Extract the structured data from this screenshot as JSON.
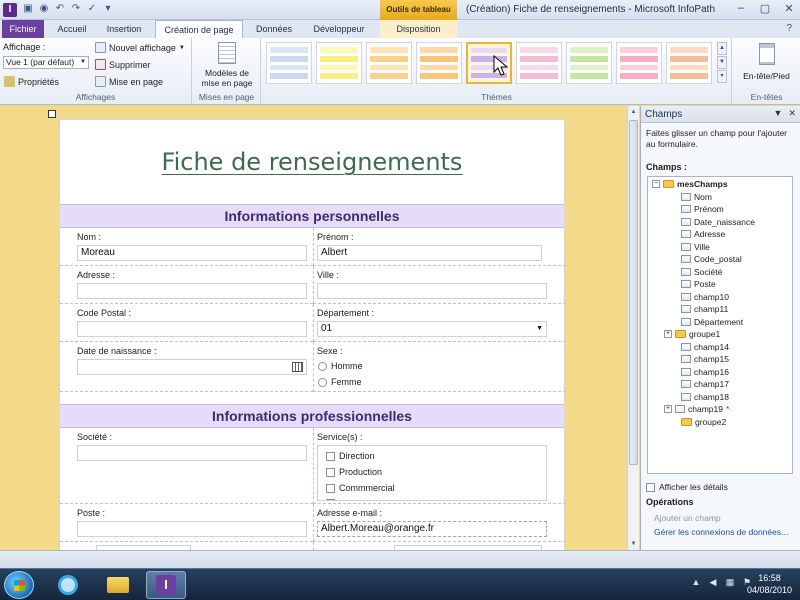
{
  "window": {
    "title": "(Création) Fiche de renseignements - Microsoft InfoPath",
    "app_icon_letter": "I",
    "context_tab_group": "Outils de tableau",
    "controls": [
      "–",
      "▢",
      "✕"
    ]
  },
  "tabs": [
    "Fichier",
    "Accueil",
    "Insertion",
    "Création de page",
    "Données",
    "Développeur",
    "Disposition"
  ],
  "ribbon": {
    "affichages": {
      "view_label": "Affichage :",
      "new_view": "Nouvel affichage",
      "view_value": "Vue 1 (par défaut)",
      "delete": "Supprimer",
      "properties": "Propriétés",
      "layout": "Mise en page",
      "group": "Affichages"
    },
    "mises_en_page": {
      "models_line1": "Modèles de",
      "models_line2": "mise en page",
      "group": "Mises en page"
    },
    "themes": {
      "group": "Thèmes",
      "swatches": [
        [
          "#dbe6f4",
          "#cbd9ec",
          "#dbe6f4",
          "#cbd9ec"
        ],
        [
          "#fbf7b4",
          "#f5ef86",
          "#fbf7b4",
          "#f5ef86"
        ],
        [
          "#fde3b5",
          "#fbd08c",
          "#fde3b5",
          "#fbd08c"
        ],
        [
          "#fdd9a8",
          "#fbc47b",
          "#fdd9a8",
          "#fbc47b"
        ],
        [
          "#e6dbf8",
          "#c7b4ef",
          "#e6dbf8",
          "#c7b4ef"
        ],
        [
          "#f8d9e6",
          "#f1bed3",
          "#f8d9e6",
          "#f1bed3"
        ],
        [
          "#def1c9",
          "#c3e6a0",
          "#def1c9",
          "#c3e6a0"
        ],
        [
          "#fbd0dc",
          "#f7aec3",
          "#fbd0dc",
          "#f7aec3"
        ],
        [
          "#fbd9c4",
          "#f8bc9b",
          "#fbd9c4",
          "#f8bc9b"
        ]
      ]
    },
    "entetes": {
      "header_footer": "En-tête/Pied",
      "group": "En-têtes"
    }
  },
  "form": {
    "title": "Fiche de renseignements",
    "section_personal": "Informations personnelles",
    "section_professional": "Informations professionnelles",
    "nom": {
      "label": "Nom :",
      "value": "Moreau"
    },
    "prenom": {
      "label": "Prénom :",
      "value": "Albert"
    },
    "adresse": {
      "label": "Adresse :",
      "value": ""
    },
    "ville": {
      "label": "Ville :",
      "value": ""
    },
    "code_postal": {
      "label": "Code Postal :",
      "value": ""
    },
    "departement": {
      "label": "Département :",
      "value": "01"
    },
    "date_naissance": {
      "label": "Date de naissance :",
      "value": ""
    },
    "sexe": {
      "label": "Sexe :",
      "options": [
        "Homme",
        "Femme"
      ]
    },
    "societe": {
      "label": "Société :",
      "value": ""
    },
    "services": {
      "label": "Service(s) :",
      "options": [
        "Direction",
        "Production",
        "Commmercial"
      ]
    },
    "poste": {
      "label": "Poste :",
      "value": ""
    },
    "email": {
      "label": "Adresse e-mail :",
      "value": "Albert.Moreau@orange.fr"
    }
  },
  "taskpane": {
    "title": "Champs",
    "description": "Faites glisser un champ pour l'ajouter au formulaire.",
    "champs_label": "Champs :",
    "root": "mesChamps",
    "fields": [
      "Nom",
      "Prénom",
      "Date_naissance",
      "Adresse",
      "Ville",
      "Code_postal",
      "Société",
      "Poste",
      "champ10",
      "champ11",
      "Département"
    ],
    "group1": "groupe1",
    "fields2": [
      "champ14",
      "champ15",
      "champ16",
      "champ17",
      "champ18"
    ],
    "champ19": "champ19",
    "group2": "groupe2",
    "show_details": "Afficher les détails",
    "operations": "Opérations",
    "add_field": "Ajouter un champ",
    "manage_connections": "Gérer les connexions de données..."
  },
  "taskbar": {
    "time": "16:58",
    "date": "04/08/2010"
  }
}
